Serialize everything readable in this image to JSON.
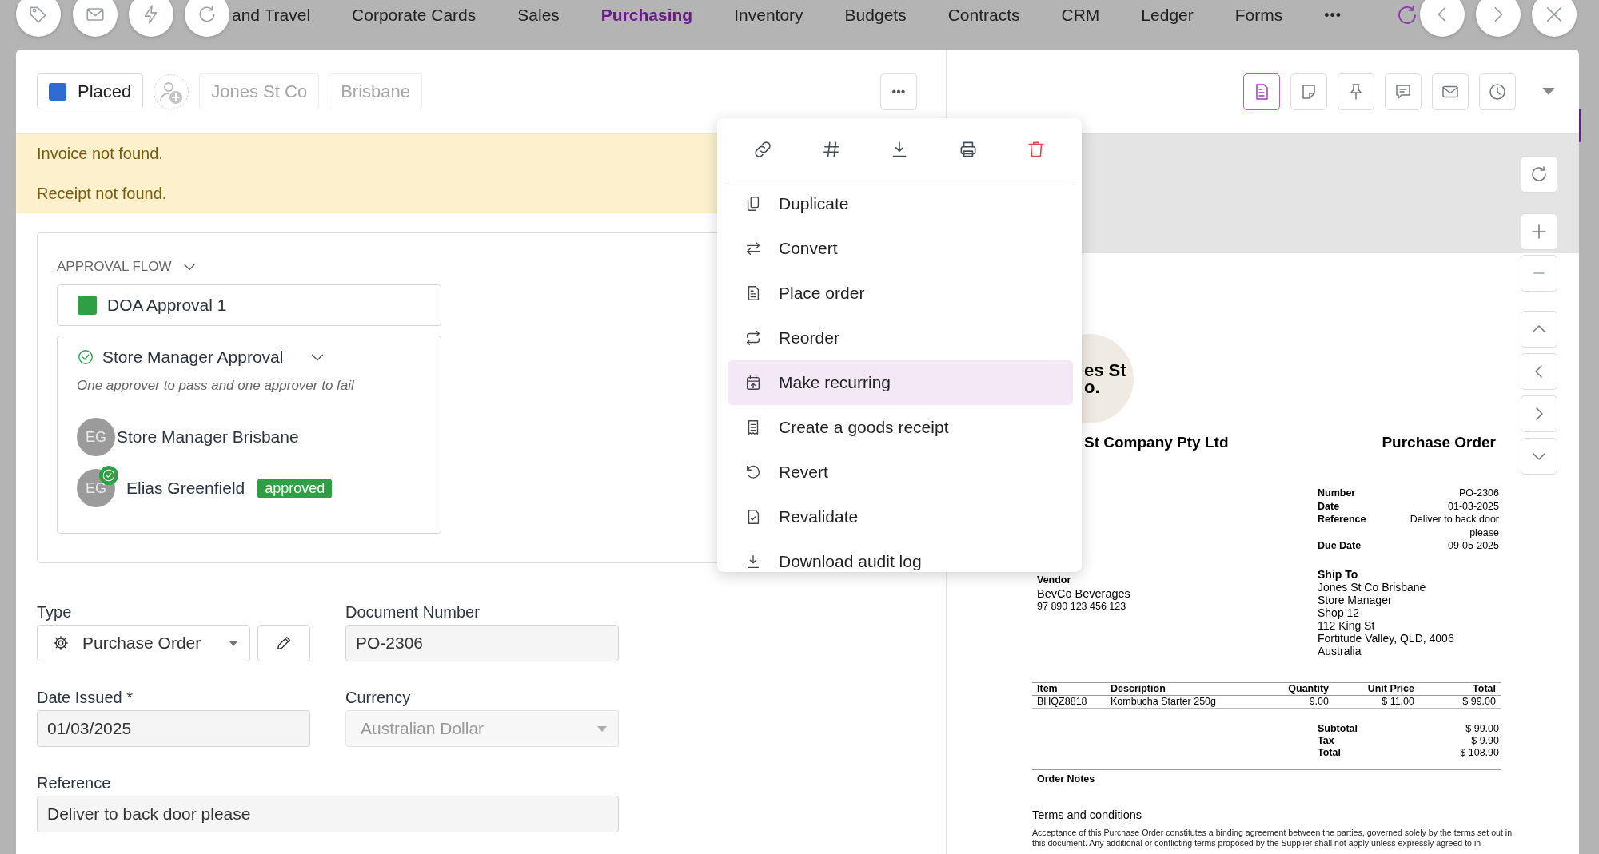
{
  "nav": {
    "items": [
      {
        "label": "and Travel",
        "selected": false
      },
      {
        "label": "Corporate Cards",
        "selected": false
      },
      {
        "label": "Sales",
        "selected": false
      },
      {
        "label": "Purchasing",
        "selected": true
      },
      {
        "label": "Inventory",
        "selected": false
      },
      {
        "label": "Budgets",
        "selected": false
      },
      {
        "label": "Contracts",
        "selected": false
      },
      {
        "label": "CRM",
        "selected": false
      },
      {
        "label": "Ledger",
        "selected": false
      },
      {
        "label": "Forms",
        "selected": false
      }
    ],
    "more": "•••"
  },
  "header": {
    "status": "Placed",
    "chips": [
      "Jones St Co",
      "Brisbane"
    ],
    "more": "•••"
  },
  "alerts": [
    "Invoice not found.",
    "Receipt not found."
  ],
  "approval_flow": {
    "title": "APPROVAL FLOW",
    "stage": "DOA Approval 1",
    "step": {
      "name": "Store Manager Approval",
      "rule": "One approver to pass and one approver to fail",
      "approvers": [
        {
          "initials": "EG",
          "name": "Store Manager Brisbane",
          "approved": false
        },
        {
          "initials": "EG",
          "name": "Elias Greenfield",
          "approved": true,
          "badge": "approved"
        }
      ]
    }
  },
  "form": {
    "type": {
      "label": "Type",
      "value": "Purchase Order"
    },
    "document_number": {
      "label": "Document Number",
      "value": "PO-2306"
    },
    "date_issued": {
      "label": "Date Issued *",
      "value": "01/03/2025"
    },
    "currency": {
      "label": "Currency",
      "value": "Australian Dollar",
      "disabled": true
    },
    "reference": {
      "label": "Reference",
      "value": "Deliver to back door please"
    }
  },
  "menu": {
    "items": [
      {
        "label": "Duplicate",
        "selected": false
      },
      {
        "label": "Convert",
        "selected": false
      },
      {
        "label": "Place order",
        "selected": false
      },
      {
        "label": "Reorder",
        "selected": false
      },
      {
        "label": "Make recurring",
        "selected": true
      },
      {
        "label": "Create a goods receipt",
        "selected": false
      },
      {
        "label": "Revert",
        "selected": false
      },
      {
        "label": "Revalidate",
        "selected": false
      },
      {
        "label": "Download audit log",
        "selected": false
      }
    ]
  },
  "viewer": {
    "tools": [
      {
        "selected": true
      },
      {
        "selected": false
      },
      {
        "selected": false
      },
      {
        "selected": false
      },
      {
        "selected": false
      },
      {
        "selected": false
      }
    ]
  },
  "document": {
    "logo": [
      "es St",
      "o."
    ],
    "company": "St Company Pty Ltd",
    "title": "Purchase Order",
    "meta": [
      {
        "label": "Number",
        "value": "PO-2306"
      },
      {
        "label": "Date",
        "value": "01-03-2025"
      },
      {
        "label": "Reference",
        "value": "Deliver to back door please"
      },
      {
        "label": "Due Date",
        "value": "09-05-2025"
      }
    ],
    "vendor": {
      "label": "Vendor",
      "name": "BevCo Beverages",
      "number": "97 890 123 456 123"
    },
    "ship_to": {
      "label": "Ship To",
      "lines": [
        "Jones St Co Brisbane",
        "Store Manager",
        "Shop 12",
        "112 King St",
        "Fortitude Valley, QLD, 4006",
        "Australia"
      ]
    },
    "table": {
      "columns": [
        "Item",
        "Description",
        "Quantity",
        "Unit Price",
        "Total"
      ],
      "rows": [
        [
          "BHQZ8818",
          "Kombucha Starter 250g",
          "9.00",
          "$ 11.00",
          "$ 99.00"
        ]
      ]
    },
    "totals": [
      {
        "label": "Subtotal",
        "value": "$ 99.00"
      },
      {
        "label": "Tax",
        "value": "$ 9.90"
      },
      {
        "label": "Total",
        "value": "$ 108.90"
      }
    ],
    "notes_title": "Order Notes",
    "terms_title": "Terms and conditions",
    "terms": "Acceptance of this Purchase Order constitutes a binding agreement between the parties, governed solely by the terms set out in this document. Any additional or conflicting terms proposed by the Supplier shall not apply unless expressly agreed to in"
  }
}
